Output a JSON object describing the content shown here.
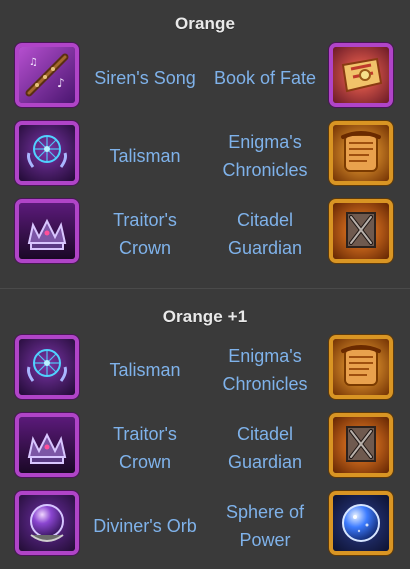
{
  "sections": [
    {
      "title": "Orange",
      "rows": [
        {
          "left": {
            "name": "Siren's Song",
            "icon": "siren-song-icon",
            "frame_color": "#b044c8"
          },
          "right": {
            "name": "Book of Fate",
            "icon": "book-of-fate-icon",
            "frame_color": "#d99523"
          }
        },
        {
          "left": {
            "name": "Talisman",
            "icon": "talisman-icon",
            "frame_color": "#b044c8"
          },
          "right": {
            "name": "Enigma's Chronicles",
            "icon": "enigmas-chronicles-icon",
            "frame_color": "#d99523"
          }
        },
        {
          "left": {
            "name": "Traitor's Crown",
            "icon": "traitors-crown-icon",
            "frame_color": "#b044c8"
          },
          "right": {
            "name": "Citadel Guardian",
            "icon": "citadel-guardian-icon",
            "frame_color": "#d99523"
          }
        }
      ]
    },
    {
      "title": "Orange +1",
      "rows": [
        {
          "left": {
            "name": "Talisman",
            "icon": "talisman-icon",
            "frame_color": "#b044c8"
          },
          "right": {
            "name": "Enigma's Chronicles",
            "icon": "enigmas-chronicles-icon",
            "frame_color": "#d99523"
          }
        },
        {
          "left": {
            "name": "Traitor's Crown",
            "icon": "traitors-crown-icon",
            "frame_color": "#b044c8"
          },
          "right": {
            "name": "Citadel Guardian",
            "icon": "citadel-guardian-icon",
            "frame_color": "#d99523"
          }
        },
        {
          "left": {
            "name": "Diviner's Orb",
            "icon": "diviners-orb-icon",
            "frame_color": "#b044c8"
          },
          "right": {
            "name": "Sphere of Power",
            "icon": "sphere-of-power-icon",
            "frame_color": "#d99523"
          }
        }
      ]
    }
  ]
}
